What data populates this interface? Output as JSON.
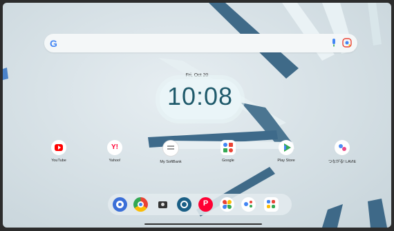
{
  "search": {
    "placeholder": ""
  },
  "clock": {
    "date": "Fri, Oct 20",
    "time": "10:08"
  },
  "apps": [
    {
      "name": "YouTube",
      "label": "YouTube",
      "color": "#ff0000"
    },
    {
      "name": "Yahoo",
      "label": "Yahoo!",
      "color": "#ff0033"
    },
    {
      "name": "My SoftBank",
      "label": "My SoftBank",
      "color": "#9e9e9e"
    },
    {
      "name": "Google",
      "label": "Google",
      "color": "#ffffff"
    },
    {
      "name": "Play Store",
      "label": "Play Store",
      "color": "#ffffff"
    },
    {
      "name": "つながる！LAVIE",
      "label": "つながる! LAVIE",
      "color": "#ffffff"
    }
  ],
  "dock": [
    {
      "name": "app-1",
      "icon": "face-chat-icon"
    },
    {
      "name": "chrome",
      "icon": "chrome-icon"
    },
    {
      "name": "camera",
      "icon": "camera-icon"
    },
    {
      "name": "settings",
      "icon": "gear-icon"
    },
    {
      "name": "paypay",
      "icon": "paypay-icon"
    },
    {
      "name": "photos",
      "icon": "photos-icon"
    },
    {
      "name": "assistant",
      "icon": "assistant-icon"
    },
    {
      "name": "app-grid",
      "icon": "app-grid-icon"
    }
  ]
}
